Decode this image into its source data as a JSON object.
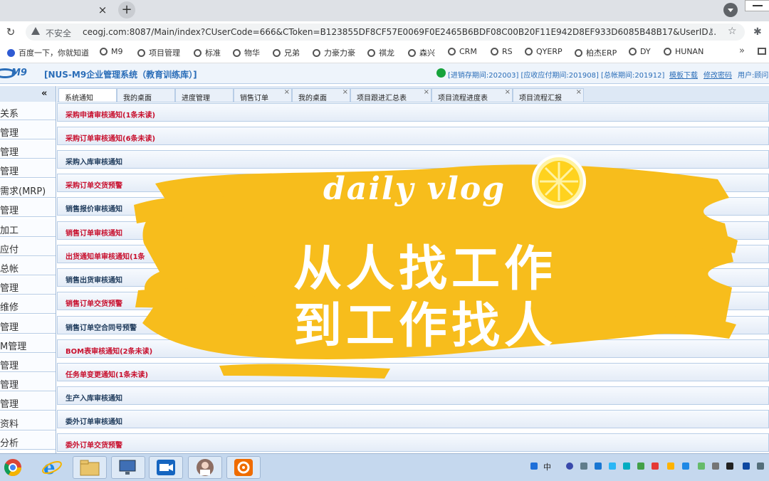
{
  "browser": {
    "tab_close": "×",
    "new_tab": "+",
    "security_label": "不安全",
    "url": "ceogj.com:8087/Main/index?CUserCode=666&CToken=B123855DF8CF57E0069F0E2465B6BDF08C00B20F11E942D8EF933D6085B48B17&UserID...",
    "bookmarks": [
      "百度一下，你就知道",
      "M9",
      "项目管理",
      "标准",
      "物华",
      "兄弟",
      "力豪力豪",
      "祺龙",
      "森兴",
      "CRM",
      "RS",
      "QYERP",
      "柏杰ERP",
      "DY",
      "HUNAN"
    ],
    "bookmarks_more": "»"
  },
  "app": {
    "logo_text": "M9",
    "title": "[NUS-M9企业管理系统（教育训练库）]",
    "periods": "[进销存期间:202003] [应收应付期间:201908] [总帐期间:201912]",
    "template_download": "模板下载",
    "change_password": "修改密码",
    "user": "用户:顾问"
  },
  "nav": {
    "collapse": "«",
    "items": [
      "关系",
      "管理",
      "管理",
      "管理",
      "需求(MRP)",
      "管理",
      "加工",
      "应付",
      "总帐",
      "管理",
      "维修",
      "管理",
      "M管理",
      "管理",
      "管理",
      "管理",
      "资料",
      "分析"
    ]
  },
  "tabs": [
    {
      "label": "系统通知",
      "close": ""
    },
    {
      "label": "我的桌面",
      "close": ""
    },
    {
      "label": "进度管理",
      "close": ""
    },
    {
      "label": "销售订单",
      "close": "×"
    },
    {
      "label": "我的桌面",
      "close": "×"
    },
    {
      "label": "项目跟进汇总表",
      "close": "×"
    },
    {
      "label": "项目流程进度表",
      "close": "×"
    },
    {
      "label": "项目流程汇报",
      "close": "×"
    }
  ],
  "notices": [
    {
      "text": "采购申请审核通知(1条未读)",
      "color": "#c8102e"
    },
    {
      "text": "采购订单审核通知(6条未读)",
      "color": "#c8102e"
    },
    {
      "text": "采购入库审核通知",
      "color": "#1f3b5c"
    },
    {
      "text": "采购订单交货预警",
      "color": "#c8102e"
    },
    {
      "text": "销售报价审核通知",
      "color": "#1f3b5c"
    },
    {
      "text": "销售订单审核通知",
      "color": "#c8102e"
    },
    {
      "text": "出货通知单审核通知(1条",
      "color": "#c8102e"
    },
    {
      "text": "销售出货审核通知",
      "color": "#1f3b5c"
    },
    {
      "text": "销售订单交货预警",
      "color": "#c8102e"
    },
    {
      "text": "销售订单空合同号预警",
      "color": "#1f3b5c"
    },
    {
      "text": "BOM表审核通知(2条未读)",
      "color": "#c8102e"
    },
    {
      "text": "任务单变更通知(1条未读)",
      "color": "#c8102e"
    },
    {
      "text": "生产入库审核通知",
      "color": "#1f3b5c"
    },
    {
      "text": "委外订单审核通知",
      "color": "#1f3b5c"
    },
    {
      "text": "委外订单交货预警",
      "color": "#c8102e"
    }
  ],
  "overlay": {
    "subtitle": "daily vlog",
    "line1": "从人找工作",
    "line2": "到工作找人",
    "brush_color": "#f7bd1c"
  },
  "taskbar": {
    "apps": [
      "chrome-icon",
      "ie-icon",
      "explorer-icon",
      "network-icon",
      "meeting-icon",
      "avatar-icon",
      "settings-icon"
    ],
    "tray_ime": "中"
  }
}
